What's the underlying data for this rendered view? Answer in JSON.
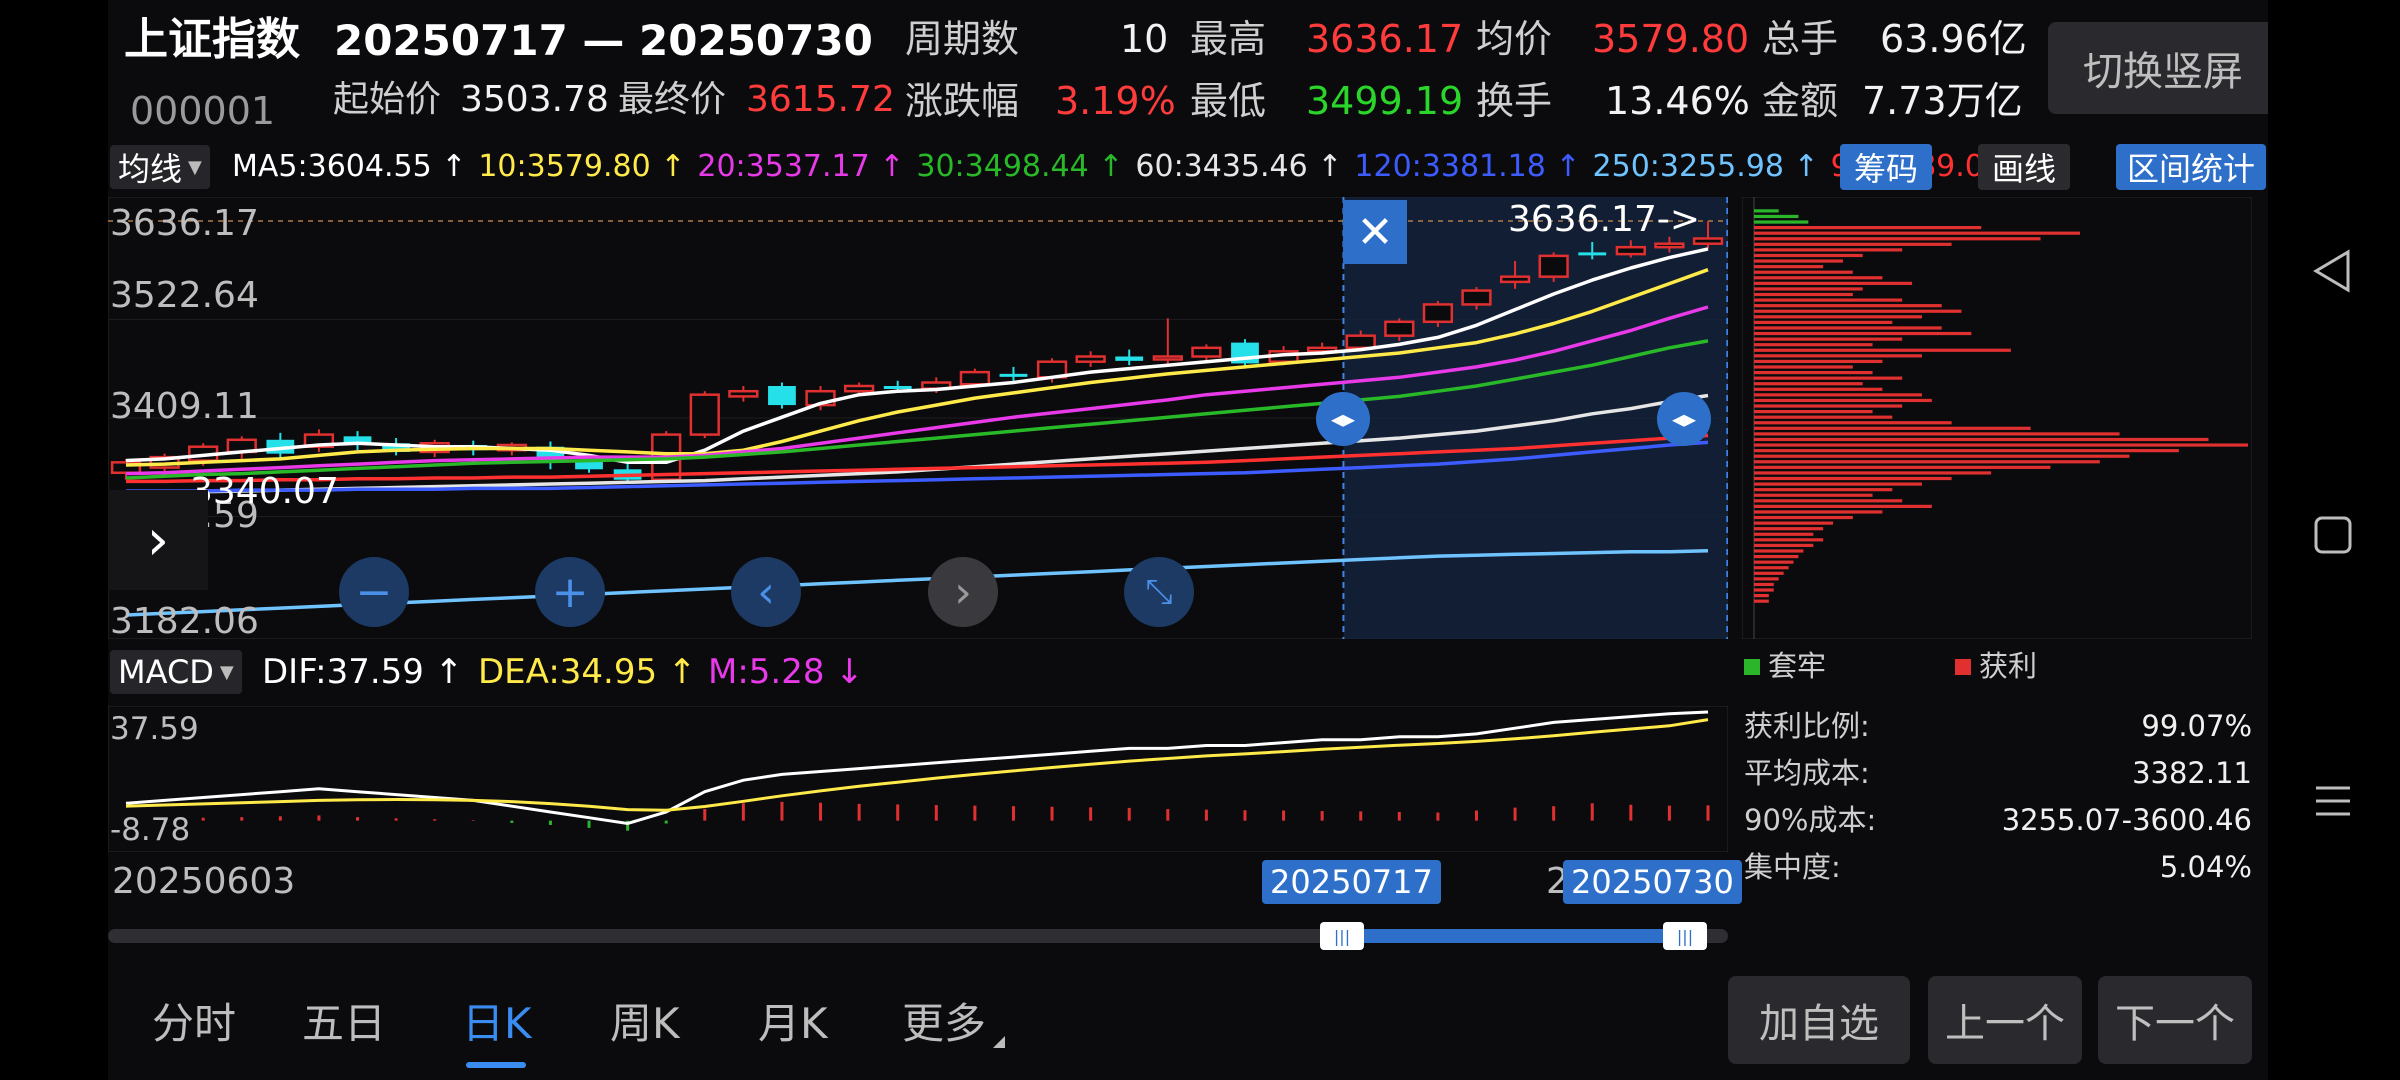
{
  "header": {
    "index_name": "上证指数",
    "index_code": "000001",
    "date_range": "20250717 — 20250730",
    "fields": {
      "period_label": "周期数",
      "period_value": "10",
      "high_label": "最高",
      "high_value": "3636.17",
      "avg_label": "均价",
      "avg_value": "3579.80",
      "volume_label": "总手",
      "volume_value": "63.96亿",
      "start_label": "起始价",
      "start_value": "3503.78",
      "end_label": "最终价",
      "end_value": "3615.72",
      "change_label": "涨跌幅",
      "change_value": "3.19%",
      "low_label": "最低",
      "low_value": "3499.19",
      "turnover_label": "换手",
      "turnover_value": "13.46%",
      "amount_label": "金额",
      "amount_value": "7.73万亿"
    },
    "portrait_button": "切换竖屏"
  },
  "ma_bar": {
    "selector": "均线",
    "items": [
      {
        "text": "MA5:3604.55 ↑",
        "color": "#ffffff"
      },
      {
        "text": "10:3579.80 ↑",
        "color": "#ffea4a"
      },
      {
        "text": "20:3537.17 ↑",
        "color": "#e83ae8"
      },
      {
        "text": "30:3498.44 ↑",
        "color": "#28b828"
      },
      {
        "text": "60:3435.46 ↑",
        "color": "#e6e6e6"
      },
      {
        "text": "120:3381.18 ↑",
        "color": "#3d5cff"
      },
      {
        "text": "250:3255.98 ↑",
        "color": "#6fc3ff"
      },
      {
        "text": "90:3389.07 ↑",
        "color": "#ff3030"
      }
    ],
    "buttons": {
      "chips": "筹码",
      "draw": "画线",
      "range_stats": "区间统计"
    }
  },
  "price_axis": [
    "3636.17",
    "3522.64",
    "3409.11",
    "3295.59",
    "3182.06"
  ],
  "annotations": {
    "high_marker": "3636.17->",
    "low_marker": "3340.07"
  },
  "macd_bar": {
    "selector": "MACD",
    "dif": "DIF:37.59 ↑",
    "dea": "DEA:34.95 ↑",
    "m": "M:5.28 ↓"
  },
  "macd_axis": {
    "top": "37.59",
    "bottom": "-8.78"
  },
  "date_axis": {
    "start": "20250603",
    "range_start": "20250717",
    "range_end": "20250730",
    "range_end_prefix": "2"
  },
  "chips_panel": {
    "legend_trapped": "套牢",
    "legend_profit": "获利",
    "stats": [
      {
        "label": "获利比例:",
        "value": "99.07%"
      },
      {
        "label": "平均成本:",
        "value": "3382.11"
      },
      {
        "label": "90%成本:",
        "value": "3255.07-3600.46"
      },
      {
        "label": "集中度:",
        "value": "5.04%"
      }
    ]
  },
  "tabs": [
    {
      "label": "分时",
      "active": false
    },
    {
      "label": "五日",
      "active": false
    },
    {
      "label": "日K",
      "active": true
    },
    {
      "label": "周K",
      "active": false
    },
    {
      "label": "月K",
      "active": false
    },
    {
      "label": "更多",
      "active": false
    }
  ],
  "actions": {
    "add_watchlist": "加自选",
    "prev": "上一个",
    "next": "下一个"
  },
  "colors": {
    "up": "#e03030",
    "down": "#25e0e8",
    "accent": "#2e70c9",
    "profit": "#e03030",
    "trapped": "#2bb52b"
  },
  "chart_data": {
    "type": "candlestick",
    "price_range": [
      3182.06,
      3636.17
    ],
    "candles": [
      {
        "o": 3346,
        "c": 3358,
        "h": 3362,
        "l": 3338
      },
      {
        "o": 3352,
        "c": 3364,
        "h": 3368,
        "l": 3344
      },
      {
        "o": 3360,
        "c": 3376,
        "h": 3380,
        "l": 3354
      },
      {
        "o": 3370,
        "c": 3384,
        "h": 3388,
        "l": 3362
      },
      {
        "o": 3384,
        "c": 3368,
        "h": 3392,
        "l": 3360
      },
      {
        "o": 3376,
        "c": 3390,
        "h": 3396,
        "l": 3370
      },
      {
        "o": 3388,
        "c": 3378,
        "h": 3394,
        "l": 3372
      },
      {
        "o": 3380,
        "c": 3370,
        "h": 3386,
        "l": 3366
      },
      {
        "o": 3370,
        "c": 3380,
        "h": 3384,
        "l": 3364
      },
      {
        "o": 3378,
        "c": 3372,
        "h": 3383,
        "l": 3366
      },
      {
        "o": 3372,
        "c": 3378,
        "h": 3381,
        "l": 3366
      },
      {
        "o": 3376,
        "c": 3360,
        "h": 3382,
        "l": 3350
      },
      {
        "o": 3360,
        "c": 3350,
        "h": 3366,
        "l": 3346
      },
      {
        "o": 3350,
        "c": 3338,
        "h": 3356,
        "l": 3334
      },
      {
        "o": 3338,
        "c": 3390,
        "h": 3394,
        "l": 3334
      },
      {
        "o": 3390,
        "c": 3436,
        "h": 3440,
        "l": 3386
      },
      {
        "o": 3434,
        "c": 3440,
        "h": 3446,
        "l": 3428
      },
      {
        "o": 3446,
        "c": 3424,
        "h": 3450,
        "l": 3420
      },
      {
        "o": 3424,
        "c": 3440,
        "h": 3446,
        "l": 3418
      },
      {
        "o": 3440,
        "c": 3446,
        "h": 3450,
        "l": 3434
      },
      {
        "o": 3446,
        "c": 3443,
        "h": 3452,
        "l": 3438
      },
      {
        "o": 3443,
        "c": 3450,
        "h": 3456,
        "l": 3438
      },
      {
        "o": 3448,
        "c": 3462,
        "h": 3466,
        "l": 3444
      },
      {
        "o": 3460,
        "c": 3458,
        "h": 3468,
        "l": 3452
      },
      {
        "o": 3456,
        "c": 3474,
        "h": 3478,
        "l": 3450
      },
      {
        "o": 3474,
        "c": 3480,
        "h": 3486,
        "l": 3468
      },
      {
        "o": 3480,
        "c": 3475,
        "h": 3488,
        "l": 3470
      },
      {
        "o": 3478,
        "c": 3480,
        "h": 3524,
        "l": 3470
      },
      {
        "o": 3480,
        "c": 3490,
        "h": 3494,
        "l": 3474
      },
      {
        "o": 3496,
        "c": 3472,
        "h": 3500,
        "l": 3466
      },
      {
        "o": 3474,
        "c": 3486,
        "h": 3492,
        "l": 3470
      },
      {
        "o": 3486,
        "c": 3490,
        "h": 3496,
        "l": 3482
      },
      {
        "o": 3490,
        "c": 3504,
        "h": 3510,
        "l": 3486
      },
      {
        "o": 3504,
        "c": 3520,
        "h": 3524,
        "l": 3498
      },
      {
        "o": 3520,
        "c": 3540,
        "h": 3544,
        "l": 3514
      },
      {
        "o": 3540,
        "c": 3556,
        "h": 3560,
        "l": 3534
      },
      {
        "o": 3566,
        "c": 3572,
        "h": 3590,
        "l": 3558
      },
      {
        "o": 3572,
        "c": 3596,
        "h": 3600,
        "l": 3566
      },
      {
        "o": 3600,
        "c": 3598,
        "h": 3612,
        "l": 3592
      },
      {
        "o": 3598,
        "c": 3606,
        "h": 3614,
        "l": 3594
      },
      {
        "o": 3606,
        "c": 3610,
        "h": 3618,
        "l": 3600
      },
      {
        "o": 3610,
        "c": 3616,
        "h": 3636,
        "l": 3604
      }
    ],
    "ma_lines": [
      {
        "name": "MA5",
        "color": "#ffffff",
        "values": [
          3360,
          3362,
          3366,
          3370,
          3374,
          3378,
          3380,
          3378,
          3376,
          3376,
          3374,
          3372,
          3366,
          3358,
          3358,
          3372,
          3394,
          3410,
          3426,
          3436,
          3440,
          3442,
          3446,
          3450,
          3456,
          3462,
          3466,
          3470,
          3474,
          3478,
          3482,
          3484,
          3488,
          3494,
          3502,
          3516,
          3534,
          3552,
          3568,
          3582,
          3594,
          3604
        ]
      },
      {
        "name": "10",
        "color": "#ffea4a",
        "values": [
          3355,
          3356,
          3358,
          3360,
          3362,
          3366,
          3370,
          3372,
          3373,
          3374,
          3374,
          3374,
          3372,
          3370,
          3368,
          3368,
          3372,
          3382,
          3394,
          3406,
          3416,
          3424,
          3432,
          3438,
          3444,
          3450,
          3455,
          3460,
          3464,
          3468,
          3472,
          3476,
          3480,
          3484,
          3490,
          3496,
          3506,
          3518,
          3532,
          3548,
          3564,
          3580
        ]
      },
      {
        "name": "20",
        "color": "#e83ae8",
        "values": [
          3345,
          3346,
          3348,
          3350,
          3352,
          3354,
          3356,
          3358,
          3360,
          3361,
          3362,
          3363,
          3364,
          3364,
          3364,
          3366,
          3370,
          3374,
          3380,
          3386,
          3392,
          3398,
          3404,
          3410,
          3415,
          3420,
          3425,
          3430,
          3436,
          3440,
          3444,
          3448,
          3452,
          3456,
          3462,
          3468,
          3476,
          3486,
          3498,
          3510,
          3524,
          3537
        ]
      },
      {
        "name": "30",
        "color": "#28b828",
        "values": [
          3340,
          3342,
          3344,
          3345,
          3347,
          3349,
          3351,
          3353,
          3355,
          3357,
          3358,
          3359,
          3360,
          3361,
          3362,
          3364,
          3367,
          3370,
          3374,
          3378,
          3382,
          3386,
          3390,
          3394,
          3398,
          3402,
          3406,
          3410,
          3414,
          3418,
          3422,
          3426,
          3430,
          3434,
          3440,
          3446,
          3454,
          3462,
          3470,
          3480,
          3490,
          3498
        ]
      },
      {
        "name": "60",
        "color": "#e6e6e6",
        "values": [
          3322,
          3323,
          3324,
          3325,
          3326,
          3327,
          3328,
          3329,
          3330,
          3331,
          3332,
          3333,
          3334,
          3335,
          3336,
          3337,
          3339,
          3341,
          3343,
          3345,
          3347,
          3350,
          3353,
          3356,
          3359,
          3362,
          3365,
          3368,
          3371,
          3374,
          3377,
          3380,
          3383,
          3386,
          3390,
          3394,
          3400,
          3406,
          3414,
          3420,
          3428,
          3435
        ]
      },
      {
        "name": "120",
        "color": "#3d5cff",
        "values": [
          3325,
          3325,
          3325,
          3326,
          3326,
          3326,
          3327,
          3327,
          3327,
          3328,
          3328,
          3328,
          3329,
          3330,
          3331,
          3332,
          3333,
          3334,
          3335,
          3336,
          3337,
          3338,
          3339,
          3340,
          3341,
          3342,
          3343,
          3344,
          3345,
          3346,
          3348,
          3350,
          3352,
          3354,
          3356,
          3359,
          3362,
          3366,
          3370,
          3374,
          3378,
          3381
        ]
      },
      {
        "name": "250",
        "color": "#6fc3ff",
        "values": [
          3182,
          3184,
          3186,
          3188,
          3190,
          3192,
          3194,
          3196,
          3198,
          3200,
          3202,
          3204,
          3206,
          3208,
          3210,
          3212,
          3214,
          3216,
          3218,
          3220,
          3222,
          3224,
          3226,
          3228,
          3230,
          3232,
          3234,
          3236,
          3238,
          3240,
          3242,
          3244,
          3246,
          3248,
          3250,
          3251,
          3252,
          3253,
          3254,
          3255,
          3255,
          3256
        ]
      },
      {
        "name": "90",
        "color": "#ff3030",
        "values": [
          3336,
          3336,
          3337,
          3337,
          3338,
          3338,
          3339,
          3339,
          3340,
          3340,
          3341,
          3341,
          3342,
          3343,
          3344,
          3345,
          3346,
          3347,
          3348,
          3349,
          3350,
          3351,
          3352,
          3353,
          3354,
          3355,
          3356,
          3357,
          3358,
          3360,
          3362,
          3364,
          3366,
          3368,
          3370,
          3372,
          3374,
          3377,
          3380,
          3383,
          3386,
          3389
        ]
      }
    ],
    "macd": {
      "range": [
        -8.78,
        37.59
      ],
      "dif": [
        6,
        7,
        8,
        9,
        10,
        11,
        10,
        9,
        8,
        7,
        5,
        3,
        1,
        -1,
        3,
        10,
        14,
        16,
        17,
        18,
        19,
        20,
        21,
        22,
        23,
        24,
        25,
        25,
        26,
        26,
        27,
        28,
        28,
        29,
        29,
        30,
        32,
        34,
        35,
        36,
        37,
        37.59
      ],
      "dea": [
        5,
        5.4,
        5.8,
        6.2,
        6.6,
        7,
        7.2,
        7.3,
        7.2,
        7,
        6.6,
        5.9,
        5,
        3.8,
        3.6,
        4.9,
        6.7,
        8.6,
        10.3,
        11.9,
        13.3,
        14.7,
        16,
        17.2,
        18.4,
        19.5,
        20.6,
        21.5,
        22.4,
        23.1,
        23.9,
        24.7,
        25.4,
        26.1,
        26.7,
        27.4,
        28.3,
        29.4,
        30.6,
        31.7,
        32.8,
        34.95
      ],
      "hist": [
        0.5,
        0.8,
        1,
        1.2,
        1.5,
        1.8,
        1.2,
        0.8,
        0.5,
        0.2,
        -0.8,
        -1.5,
        -2.5,
        -3.5,
        -1,
        4,
        6,
        6.5,
        6.2,
        5.8,
        5.6,
        5.4,
        5.2,
        5,
        4.8,
        4.6,
        4.4,
        4,
        3.8,
        3.6,
        3.5,
        3.3,
        3.2,
        3,
        2.8,
        3.5,
        4.5,
        5,
        6,
        5.5,
        5.2,
        5.28
      ]
    },
    "chips": {
      "price_range": [
        3182.06,
        3636.17
      ],
      "bars": [
        {
          "p": 3632,
          "w": 0.05,
          "g": true
        },
        {
          "p": 3626,
          "w": 0.09,
          "g": true
        },
        {
          "p": 3620,
          "w": 0.11,
          "g": true
        },
        {
          "p": 3614,
          "w": 0.46
        },
        {
          "p": 3608,
          "w": 0.66
        },
        {
          "p": 3602,
          "w": 0.58
        },
        {
          "p": 3596,
          "w": 0.4
        },
        {
          "p": 3590,
          "w": 0.3
        },
        {
          "p": 3584,
          "w": 0.22
        },
        {
          "p": 3578,
          "w": 0.18
        },
        {
          "p": 3572,
          "w": 0.14
        },
        {
          "p": 3566,
          "w": 0.2
        },
        {
          "p": 3560,
          "w": 0.26
        },
        {
          "p": 3554,
          "w": 0.32
        },
        {
          "p": 3548,
          "w": 0.22
        },
        {
          "p": 3542,
          "w": 0.2
        },
        {
          "p": 3536,
          "w": 0.3
        },
        {
          "p": 3530,
          "w": 0.38
        },
        {
          "p": 3524,
          "w": 0.42
        },
        {
          "p": 3518,
          "w": 0.34
        },
        {
          "p": 3512,
          "w": 0.28
        },
        {
          "p": 3506,
          "w": 0.38
        },
        {
          "p": 3500,
          "w": 0.44
        },
        {
          "p": 3494,
          "w": 0.3
        },
        {
          "p": 3488,
          "w": 0.24
        },
        {
          "p": 3482,
          "w": 0.52
        },
        {
          "p": 3476,
          "w": 0.34
        },
        {
          "p": 3470,
          "w": 0.26
        },
        {
          "p": 3464,
          "w": 0.2
        },
        {
          "p": 3458,
          "w": 0.24
        },
        {
          "p": 3452,
          "w": 0.3
        },
        {
          "p": 3446,
          "w": 0.22
        },
        {
          "p": 3440,
          "w": 0.26
        },
        {
          "p": 3434,
          "w": 0.34
        },
        {
          "p": 3428,
          "w": 0.36
        },
        {
          "p": 3422,
          "w": 0.3
        },
        {
          "p": 3416,
          "w": 0.24
        },
        {
          "p": 3410,
          "w": 0.28
        },
        {
          "p": 3404,
          "w": 0.4
        },
        {
          "p": 3398,
          "w": 0.56
        },
        {
          "p": 3392,
          "w": 0.74
        },
        {
          "p": 3386,
          "w": 0.92
        },
        {
          "p": 3380,
          "w": 1.0
        },
        {
          "p": 3374,
          "w": 0.86
        },
        {
          "p": 3368,
          "w": 0.76
        },
        {
          "p": 3362,
          "w": 0.7
        },
        {
          "p": 3356,
          "w": 0.6
        },
        {
          "p": 3350,
          "w": 0.48
        },
        {
          "p": 3344,
          "w": 0.4
        },
        {
          "p": 3338,
          "w": 0.34
        },
        {
          "p": 3332,
          "w": 0.28
        },
        {
          "p": 3326,
          "w": 0.24
        },
        {
          "p": 3320,
          "w": 0.3
        },
        {
          "p": 3314,
          "w": 0.36
        },
        {
          "p": 3308,
          "w": 0.26
        },
        {
          "p": 3302,
          "w": 0.2
        },
        {
          "p": 3296,
          "w": 0.16
        },
        {
          "p": 3290,
          "w": 0.14
        },
        {
          "p": 3284,
          "w": 0.12
        },
        {
          "p": 3278,
          "w": 0.14
        },
        {
          "p": 3272,
          "w": 0.12
        },
        {
          "p": 3266,
          "w": 0.1
        },
        {
          "p": 3260,
          "w": 0.09
        },
        {
          "p": 3254,
          "w": 0.08
        },
        {
          "p": 3248,
          "w": 0.07
        },
        {
          "p": 3242,
          "w": 0.06
        },
        {
          "p": 3236,
          "w": 0.05
        },
        {
          "p": 3230,
          "w": 0.04
        },
        {
          "p": 3224,
          "w": 0.04
        },
        {
          "p": 3218,
          "w": 0.03
        },
        {
          "p": 3212,
          "w": 0.03
        }
      ]
    },
    "selection": {
      "start_index": 32,
      "end_index": 41
    }
  }
}
